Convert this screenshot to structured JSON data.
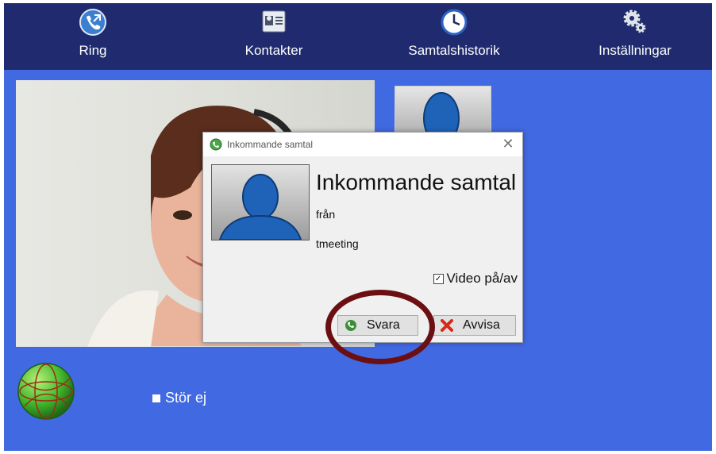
{
  "nav": {
    "items": [
      {
        "label": "Ring",
        "icon": "phone-call-icon"
      },
      {
        "label": "Kontakter",
        "icon": "contact-card-icon"
      },
      {
        "label": "Samtalshistorik",
        "icon": "clock-icon"
      },
      {
        "label": "Inställningar",
        "icon": "gear-icon"
      }
    ]
  },
  "dialog": {
    "window_title": "Inkommande samtal",
    "heading": "Inkommande samtal",
    "from_label": "från",
    "caller": "tmeeting",
    "video_toggle_label": "Video på/av",
    "video_enabled": true,
    "answer_label": "Svara",
    "decline_label": "Avvisa"
  },
  "status": {
    "dnd_label": "Stör ej",
    "dnd_enabled": false
  },
  "colors": {
    "background": "#4169e1",
    "nav_bar": "#1f2b6e",
    "annotation_ring": "#6b0f12",
    "decline_x": "#d42a1c"
  }
}
